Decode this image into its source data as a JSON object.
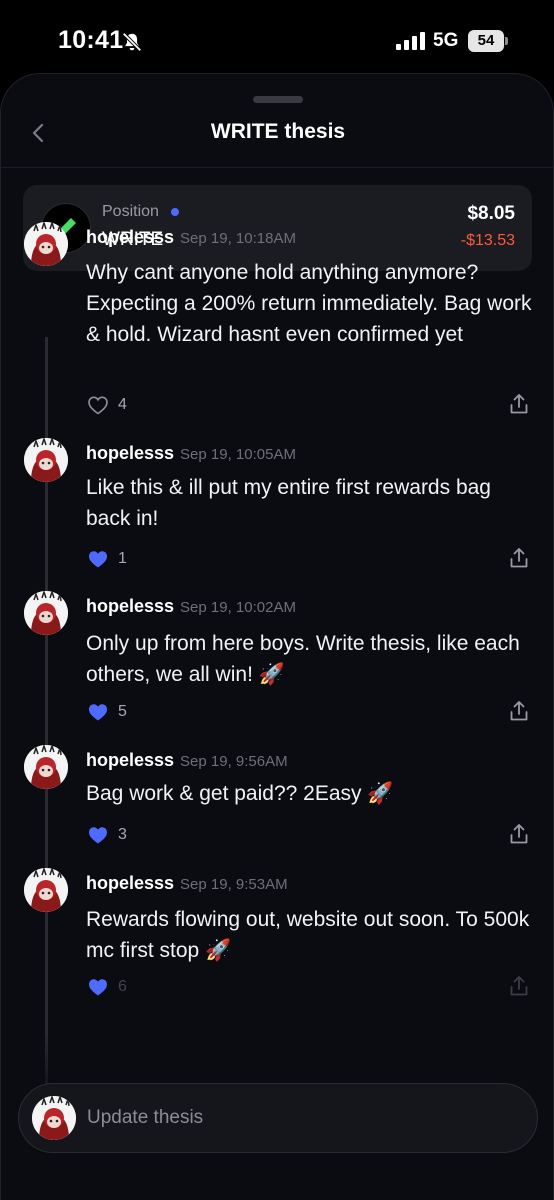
{
  "status_bar": {
    "time": "10:41",
    "network": "5G",
    "battery": "54"
  },
  "header": {
    "title": "WRITE thesis"
  },
  "position": {
    "label": "Position",
    "token": "WRITE",
    "value": "$8.05",
    "change": "-$13.53"
  },
  "posts": [
    {
      "author": "hopelesss",
      "time": "Sep 19, 10:18AM",
      "text": "Why cant anyone hold anything anymore? Expecting a 200% return immediately. Bag work & hold. Wizard hasnt even confirmed yet",
      "likes": "4",
      "liked": false
    },
    {
      "author": "hopelesss",
      "time": "Sep 19, 10:05AM",
      "text": "Like this & ill put my entire first rewards bag back in!",
      "likes": "1",
      "liked": true
    },
    {
      "author": "hopelesss",
      "time": "Sep 19, 10:02AM",
      "text": "Only up from here boys. Write thesis, like each others, we all win! 🚀",
      "likes": "5",
      "liked": true
    },
    {
      "author": "hopelesss",
      "time": "Sep 19, 9:56AM",
      "text": "Bag work & get paid?? 2Easy 🚀",
      "likes": "3",
      "liked": true
    },
    {
      "author": "hopelesss",
      "time": "Sep 19, 9:53AM",
      "text": "Rewards flowing out, website out soon. To 500k mc first stop 🚀",
      "likes": "6",
      "liked": true
    }
  ],
  "composer": {
    "placeholder": "Update thesis"
  },
  "colors": {
    "accent": "#4f6bff",
    "negative": "#ff5a3c",
    "background": "#0b0b12",
    "card": "#1b1b22"
  },
  "icons": {
    "back": "chevron-left-icon",
    "mute": "bell-slash-icon",
    "pencil": "pencil-icon",
    "like": "heart-icon",
    "share": "share-icon"
  }
}
